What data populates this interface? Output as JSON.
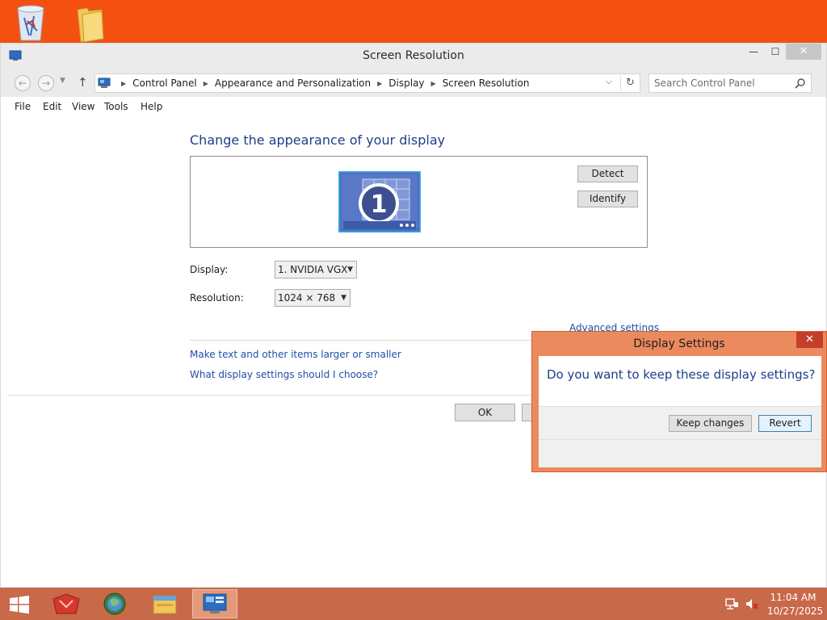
{
  "desktop": {
    "icons": [
      "recycle-bin-icon",
      "folder-icon"
    ]
  },
  "window": {
    "title": "Screen Resolution",
    "controls": {
      "minimize": "—",
      "maximize": "☐",
      "close": "✕"
    }
  },
  "address": {
    "breadcrumb": [
      "Control Panel",
      "Appearance and Personalization",
      "Display",
      "Screen Resolution"
    ],
    "search_placeholder": "Search Control Panel"
  },
  "menu": [
    "File",
    "Edit",
    "View",
    "Tools",
    "Help"
  ],
  "content": {
    "heading": "Change the appearance of your display",
    "monitor_number": "1",
    "detect_label": "Detect",
    "identify_label": "Identify",
    "display_label": "Display:",
    "display_value": "1. NVIDIA VGX",
    "resolution_label": "Resolution:",
    "resolution_value": "1024 × 768",
    "advanced_link": "Advanced settings",
    "links": [
      "Make text and other items larger or smaller",
      "What display settings should I choose?"
    ],
    "ok_label": "OK"
  },
  "dialog": {
    "title": "Display Settings",
    "message": "Do you want to keep these display settings?",
    "keep_label": "Keep changes",
    "revert_label": "Revert"
  },
  "taskbar": {
    "apps": [
      "app-icon",
      "browser-icon",
      "file-explorer-icon",
      "control-panel-icon"
    ],
    "time": "11:04 AM",
    "date": "10/27/2025"
  },
  "colors": {
    "desktop": "#f4500f",
    "taskbar": "#c8694a",
    "dialog_frame": "#eb8a5e",
    "link": "#1f4fa8"
  }
}
